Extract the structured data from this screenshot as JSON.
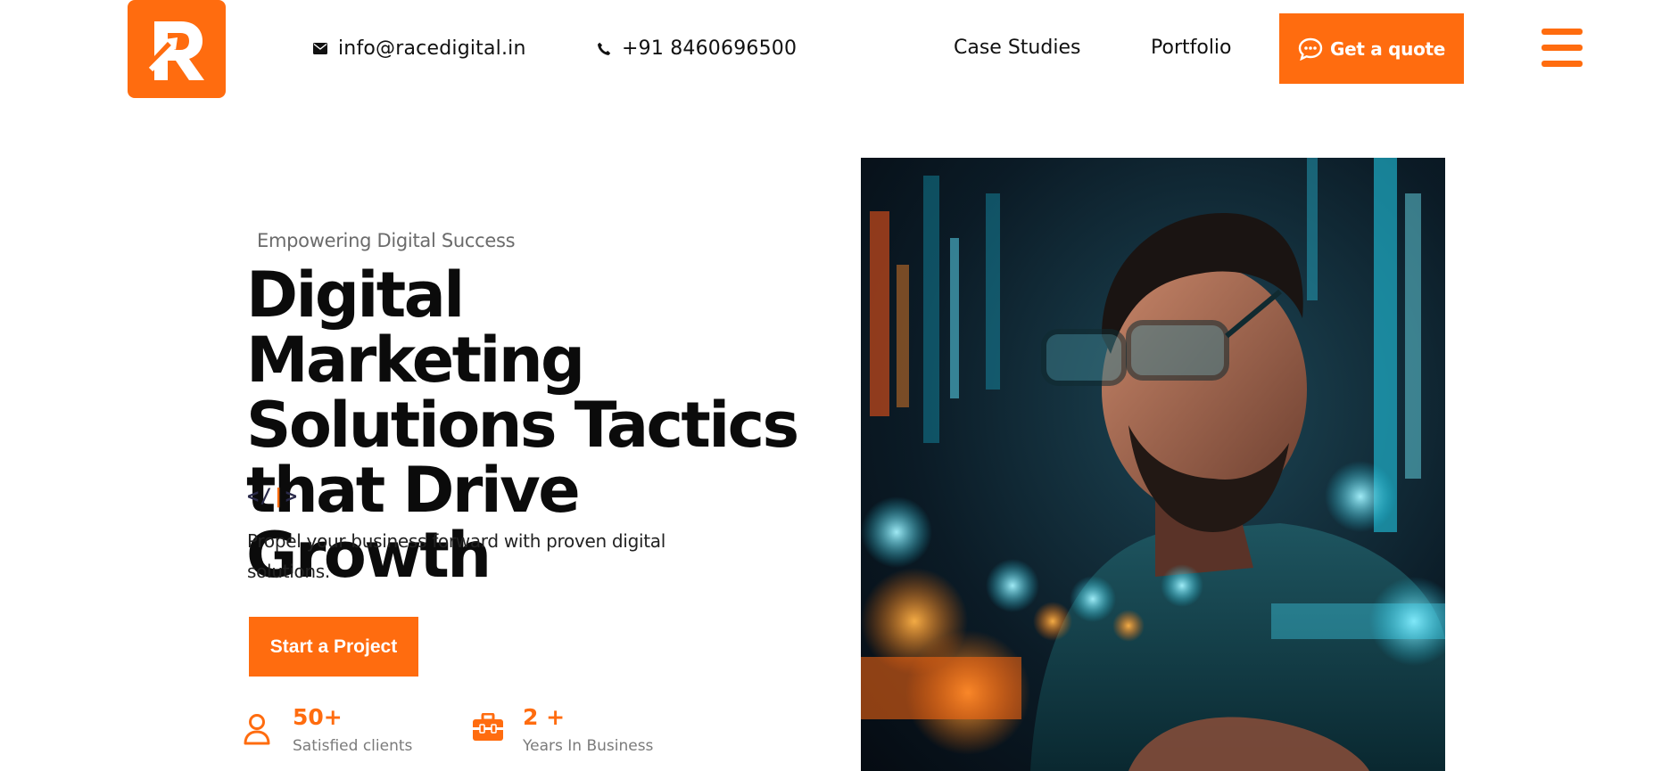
{
  "header": {
    "email": "info@racedigital.in",
    "phone": "+91 8460696500",
    "nav": [
      "Case Studies",
      "Portfolio"
    ],
    "quote_label": "Get a quote"
  },
  "hero": {
    "eyebrow": "Empowering Digital Success",
    "headline_lines": [
      "Digital Marketing",
      "Solutions Tactics",
      "that Drive Growth"
    ],
    "code_mark": {
      "open": "</",
      "bar": "|",
      "close": ">"
    },
    "description": "Propel your business forward with proven digital solutions.",
    "cta_label": "Start a Project"
  },
  "stats": [
    {
      "value": "50+",
      "label": "Satisfied clients",
      "icon": "user-icon"
    },
    {
      "value": "2 +",
      "label": "Years In Business",
      "icon": "briefcase-icon"
    }
  ],
  "colors": {
    "accent": "#ff6c0f",
    "text": "#0b0b0b",
    "muted": "#7b7b7b"
  },
  "icons": [
    "logo-r",
    "mail-icon",
    "phone-icon",
    "chat-icon",
    "hamburger-menu-icon",
    "user-icon",
    "briefcase-icon"
  ]
}
